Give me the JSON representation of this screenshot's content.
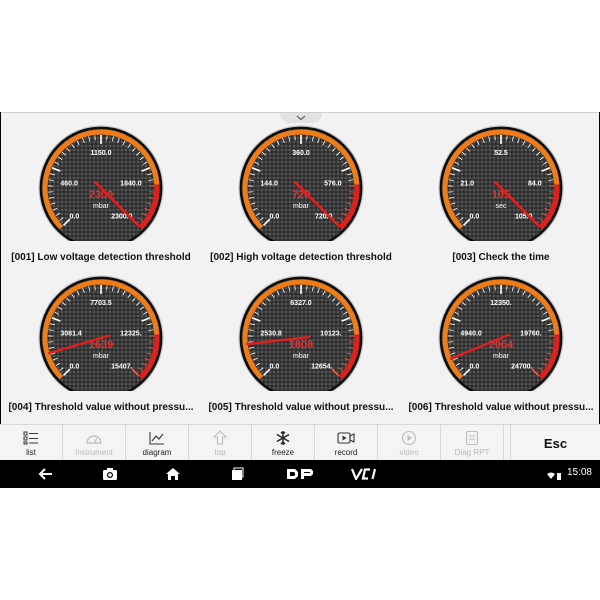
{
  "gauges": [
    {
      "id": "001",
      "label": "[001] Low voltage detection threshold",
      "ticks": [
        "0.0",
        "460.0",
        "1150.0",
        "1840.0",
        "2300.0"
      ],
      "value_text": "2300",
      "value": 2300,
      "max": 2300,
      "unit": "mbar"
    },
    {
      "id": "002",
      "label": "[002] High voltage detection threshold",
      "ticks": [
        "0.0",
        "144.0",
        "360.0",
        "576.0",
        "720.0"
      ],
      "value_text": "720",
      "value": 720,
      "max": 720,
      "unit": "mbar"
    },
    {
      "id": "003",
      "label": "[003] Check the time",
      "ticks": [
        "0.0",
        "21.0",
        "52.5",
        "84.0",
        "105.0"
      ],
      "value_text": "105",
      "value": 105,
      "max": 105,
      "unit": "sec"
    },
    {
      "id": "004",
      "label": "[004] Threshold value without pressu...",
      "ticks": [
        "0.0",
        "3081.4",
        "7703.5",
        "12325.",
        "15407."
      ],
      "value_text": "1639",
      "value": 1639,
      "max": 15407,
      "unit": "mbar"
    },
    {
      "id": "005",
      "label": "[005] Threshold value without pressu...",
      "ticks": [
        "0.0",
        "2530.8",
        "6327.0",
        "10123.",
        "12654."
      ],
      "value_text": "1808",
      "value": 1808,
      "max": 12654,
      "unit": "mbar"
    },
    {
      "id": "006",
      "label": "[006] Threshold value without pressu...",
      "ticks": [
        "0.0",
        "4940.0",
        "12350.",
        "19760.",
        "24700."
      ],
      "value_text": "2064",
      "value": 2064,
      "max": 24700,
      "unit": "mbar"
    }
  ],
  "toolbar": {
    "list": "list",
    "instrument": "Instrument",
    "diagram": "diagram",
    "top": "top",
    "freeze": "freeze",
    "record": "record",
    "video": "video",
    "diag_rpt": "Diag RPT",
    "esc": "Esc"
  },
  "status": {
    "time": "15:08"
  },
  "colors": {
    "needle": "#e31e1e",
    "arc_orange": "#f07c18",
    "arc_red": "#e0201c",
    "rim": "#1c1c1c"
  }
}
